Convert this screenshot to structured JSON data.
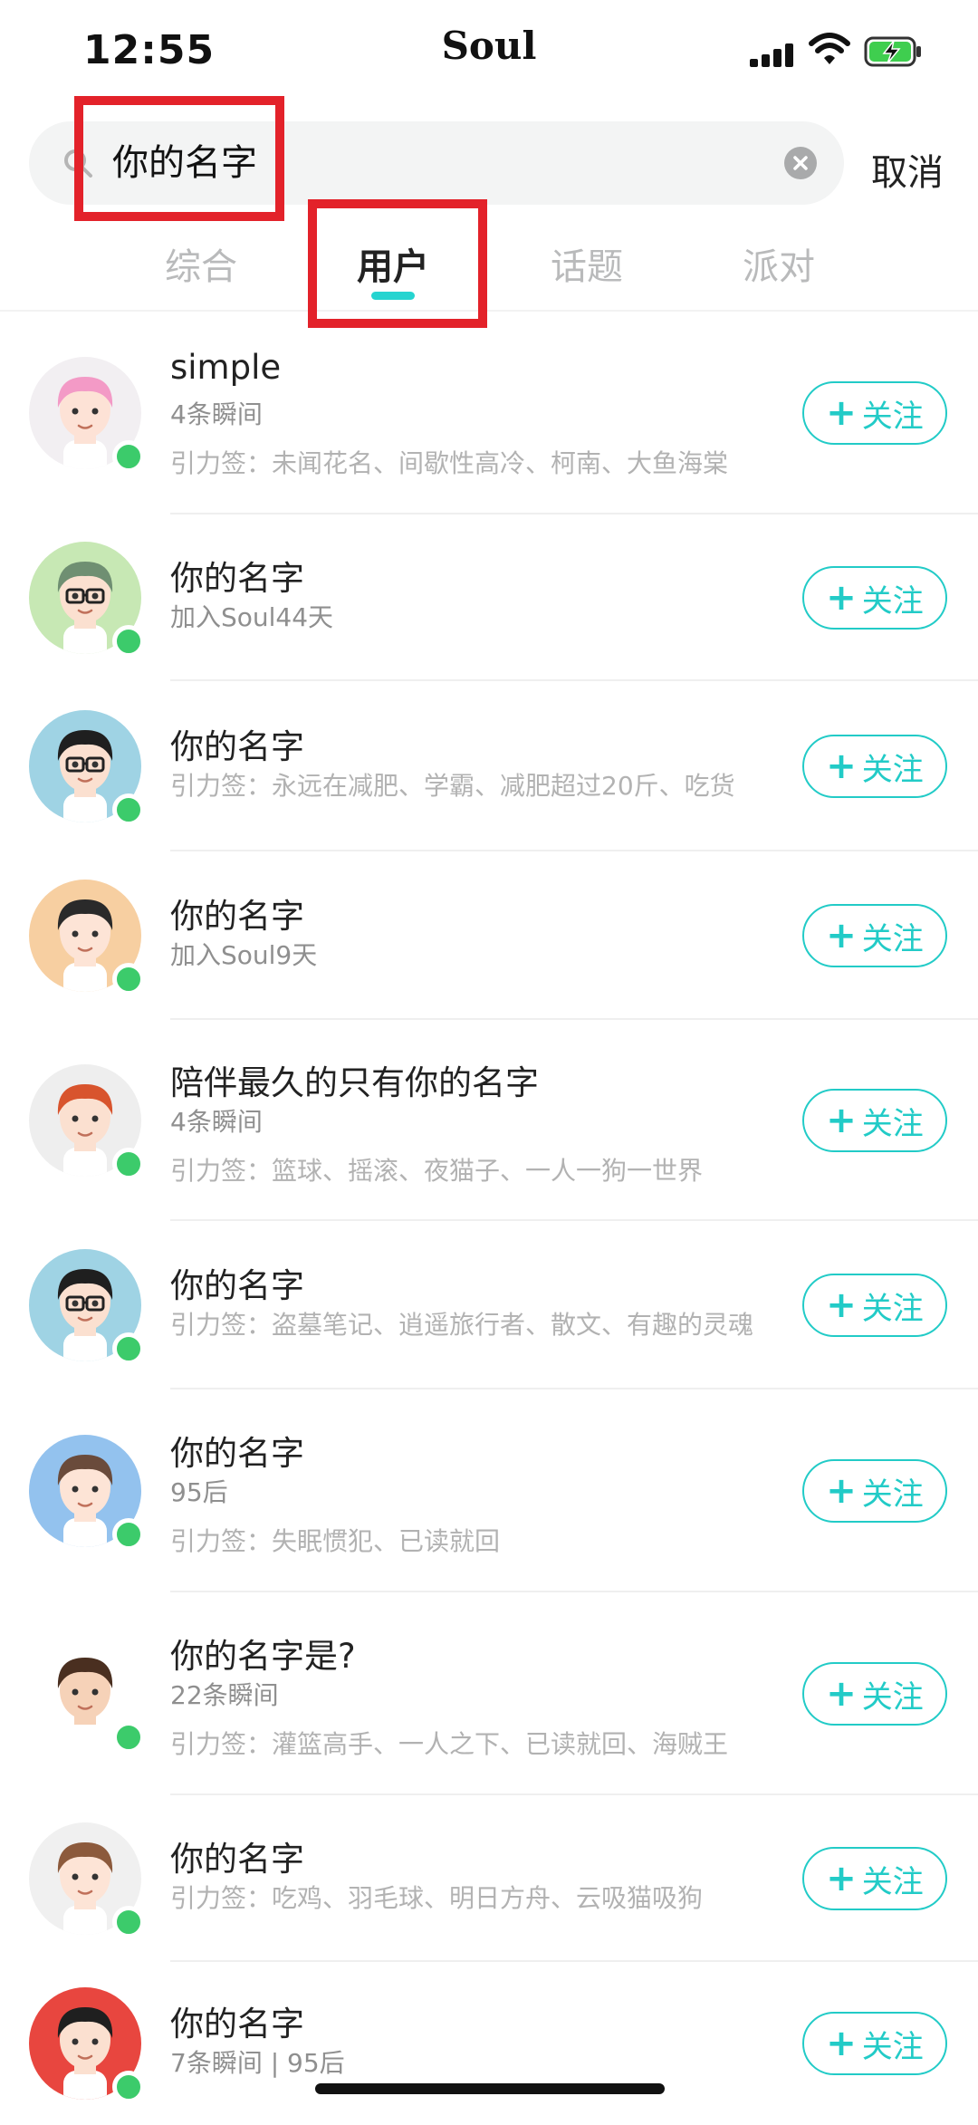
{
  "status": {
    "time": "12:55",
    "carrier": "Soul"
  },
  "search": {
    "query": "你的名字",
    "cancel": "取消"
  },
  "tabs": [
    {
      "label": "综合",
      "active": false
    },
    {
      "label": "用户",
      "active": true
    },
    {
      "label": "话题",
      "active": false
    },
    {
      "label": "派对",
      "active": false
    }
  ],
  "follow_label": "关注",
  "follow_plus": "+",
  "colors": {
    "accent": "#22cbc7",
    "online": "#3ccb6b",
    "highlight": "#e3222a"
  },
  "users": [
    {
      "name": "simple",
      "line2": "4条瞬间",
      "line3": "引力签：未闻花名、间歇性高冷、柯南、大鱼海棠",
      "avatar": "pink-hair-girl-avatar"
    },
    {
      "name": "你的名字",
      "line2": "加入Soul44天",
      "line3": "",
      "avatar": "green-hair-glasses-avatar"
    },
    {
      "name": "你的名字",
      "line2": "",
      "line3": "引力签：永远在减肥、学霸、减肥超过20斤、吃货",
      "avatar": "glasses-boy-blue-avatar"
    },
    {
      "name": "你的名字",
      "line2": "加入Soul9天",
      "line3": "",
      "avatar": "boy-orange-bg-avatar"
    },
    {
      "name": "陪伴最久的只有你的名字",
      "line2": "4条瞬间",
      "line3": "引力签：篮球、摇滚、夜猫子、一人一狗一世界",
      "avatar": "red-hair-boy-avatar"
    },
    {
      "name": "你的名字",
      "line2": "",
      "line3": "引力签：盗墓笔记、逍遥旅行者、散文、有趣的灵魂",
      "avatar": "glasses-boy-blue-avatar"
    },
    {
      "name": "你的名字",
      "line2": "95后",
      "line3": "引力签：失眠惯犯、已读就回",
      "avatar": "horns-boy-avatar"
    },
    {
      "name": "你的名字是?",
      "line2": "22条瞬间",
      "line3": "引力签：灌篮高手、一人之下、已读就回、海贼王",
      "avatar": "smiling-boy-avatar"
    },
    {
      "name": "你的名字",
      "line2": "",
      "line3": "引力签：吃鸡、羽毛球、明日方舟、云吸猫吸狗",
      "avatar": "pig-hat-boy-avatar"
    },
    {
      "name": "你的名字",
      "line2": "7条瞬间 | 95后",
      "line3": "",
      "avatar": "boy-red-bg-avatar"
    }
  ]
}
